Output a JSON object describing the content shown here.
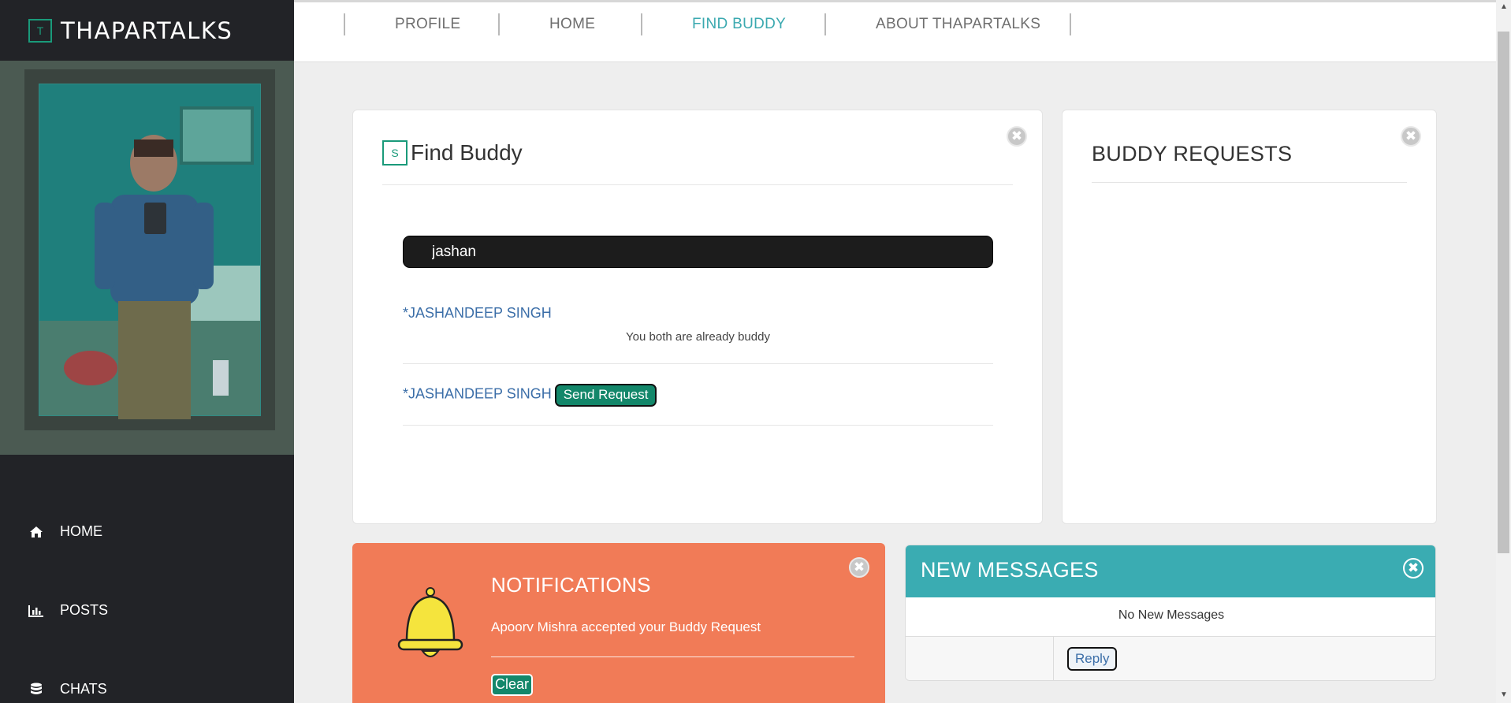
{
  "brand": {
    "logo_letter": "T",
    "name": "THAPARTALKS"
  },
  "sidebar": {
    "items": [
      {
        "label": "HOME",
        "icon": "home-icon"
      },
      {
        "label": "POSTS",
        "icon": "bar-chart-icon"
      },
      {
        "label": "CHATS",
        "icon": "database-icon"
      }
    ]
  },
  "nav": {
    "items": [
      {
        "label": "PROFILE",
        "active": false
      },
      {
        "label": "HOME",
        "active": false
      },
      {
        "label": "FIND BUDDY",
        "active": true
      },
      {
        "label": "ABOUT THAPARTALKS",
        "active": false
      }
    ]
  },
  "find_buddy": {
    "logo_letter": "S",
    "title": "Find Buddy",
    "search_value": "jashan",
    "results": [
      {
        "name": "*JASHANDEEP SINGH",
        "note": "You both are already buddy"
      },
      {
        "name": "*JASHANDEEP SINGH",
        "action_label": "Send Request"
      }
    ],
    "close_symbol": "✖"
  },
  "buddy_requests": {
    "title": "BUDDY REQUESTS",
    "close_symbol": "✖"
  },
  "notifications": {
    "title": "NOTIFICATIONS",
    "message": "Apoorv Mishra accepted your Buddy Request",
    "clear_label": "Clear",
    "close_symbol": "✖"
  },
  "new_messages": {
    "title": "NEW MESSAGES",
    "empty_text": "No New Messages",
    "reply_label": "Reply",
    "close_symbol": "✖"
  },
  "colors": {
    "sidebar_bg": "#222327",
    "accent_teal": "#3aacb2",
    "brand_green": "#1a9a7a",
    "notification_orange": "#f17b57",
    "button_green": "#13876a"
  }
}
